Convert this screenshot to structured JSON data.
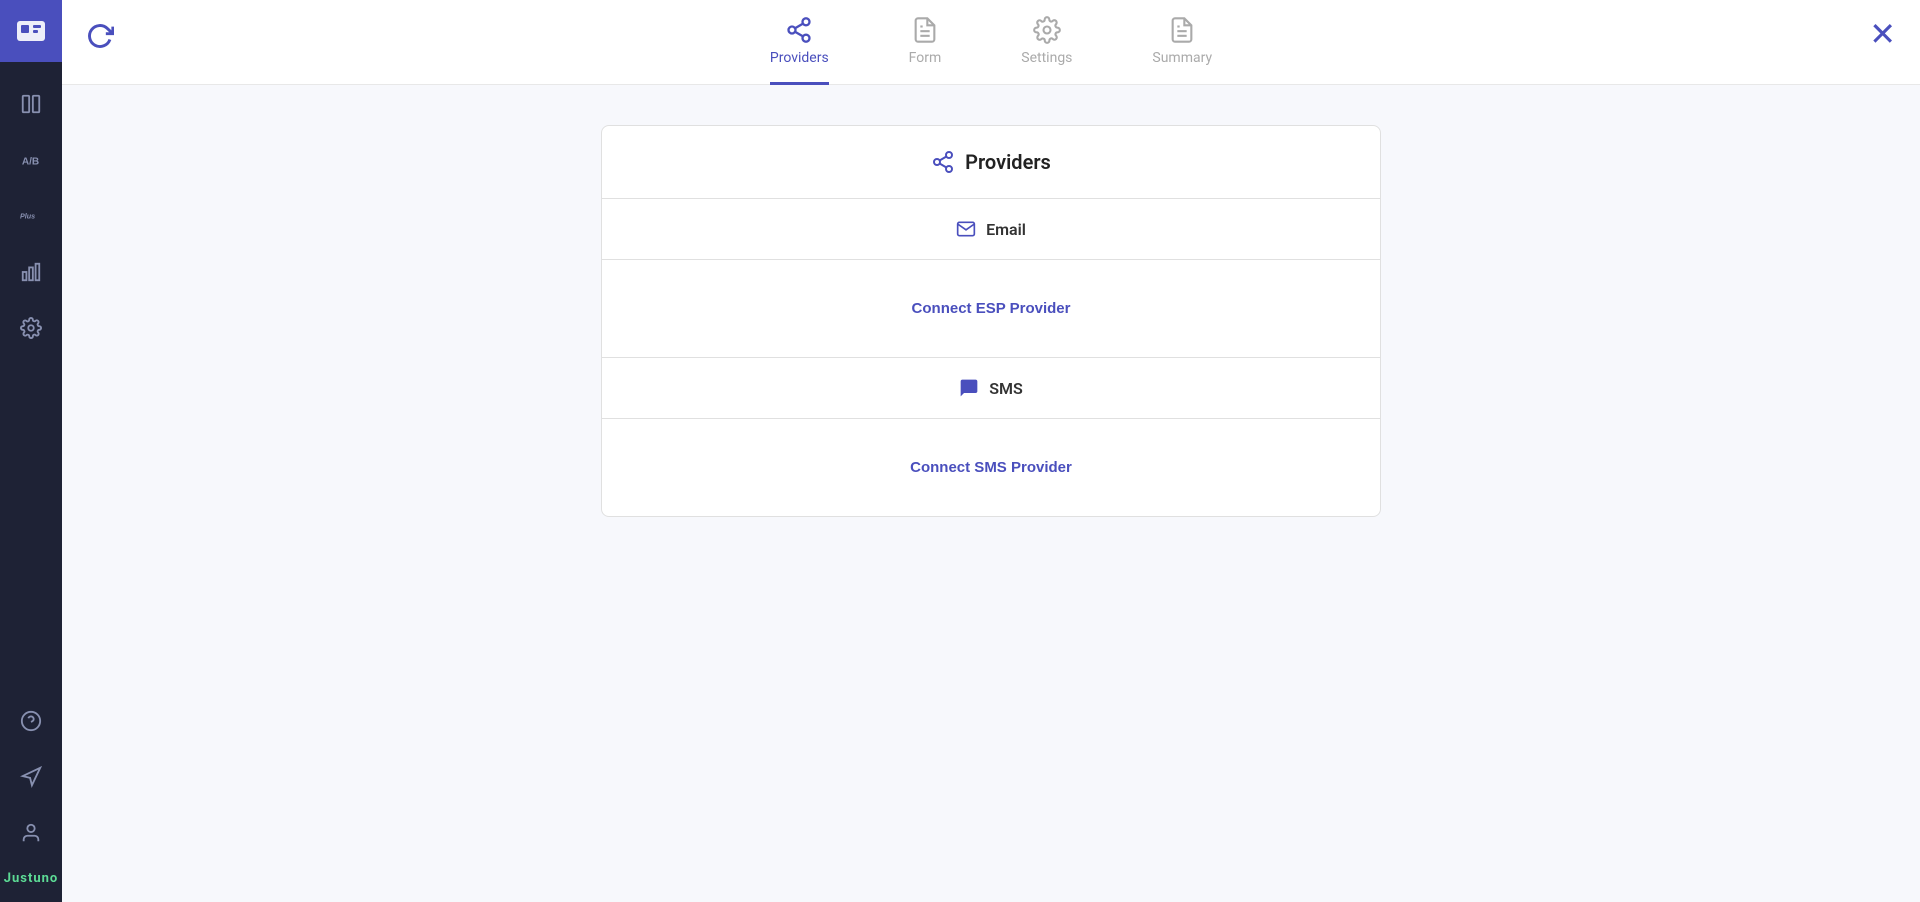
{
  "sidebar": {
    "logo_label": "Justuno Logo",
    "items": [
      {
        "id": "library",
        "label": "Library",
        "icon": "book"
      },
      {
        "id": "ab-test",
        "label": "A/B Test",
        "icon": "ab"
      },
      {
        "id": "plus",
        "label": "Plus",
        "icon": "plus-text"
      },
      {
        "id": "analytics",
        "label": "Analytics",
        "icon": "bar-chart"
      },
      {
        "id": "settings",
        "label": "Settings",
        "icon": "gear"
      }
    ],
    "bottom_items": [
      {
        "id": "help",
        "label": "Help",
        "icon": "question"
      },
      {
        "id": "megaphone",
        "label": "Announcements",
        "icon": "megaphone"
      },
      {
        "id": "account",
        "label": "Account",
        "icon": "user"
      }
    ],
    "brand": "Justuno"
  },
  "header": {
    "tabs": [
      {
        "id": "providers",
        "label": "Providers",
        "active": true
      },
      {
        "id": "form",
        "label": "Form",
        "active": false
      },
      {
        "id": "settings",
        "label": "Settings",
        "active": false
      },
      {
        "id": "summary",
        "label": "Summary",
        "active": false
      }
    ],
    "refresh_label": "Refresh",
    "close_label": "Close"
  },
  "providers_panel": {
    "title": "Providers",
    "sections": [
      {
        "id": "email",
        "type_label": "Email",
        "connect_label": "Connect ESP Provider"
      },
      {
        "id": "sms",
        "type_label": "SMS",
        "connect_label": "Connect SMS Provider"
      }
    ]
  }
}
